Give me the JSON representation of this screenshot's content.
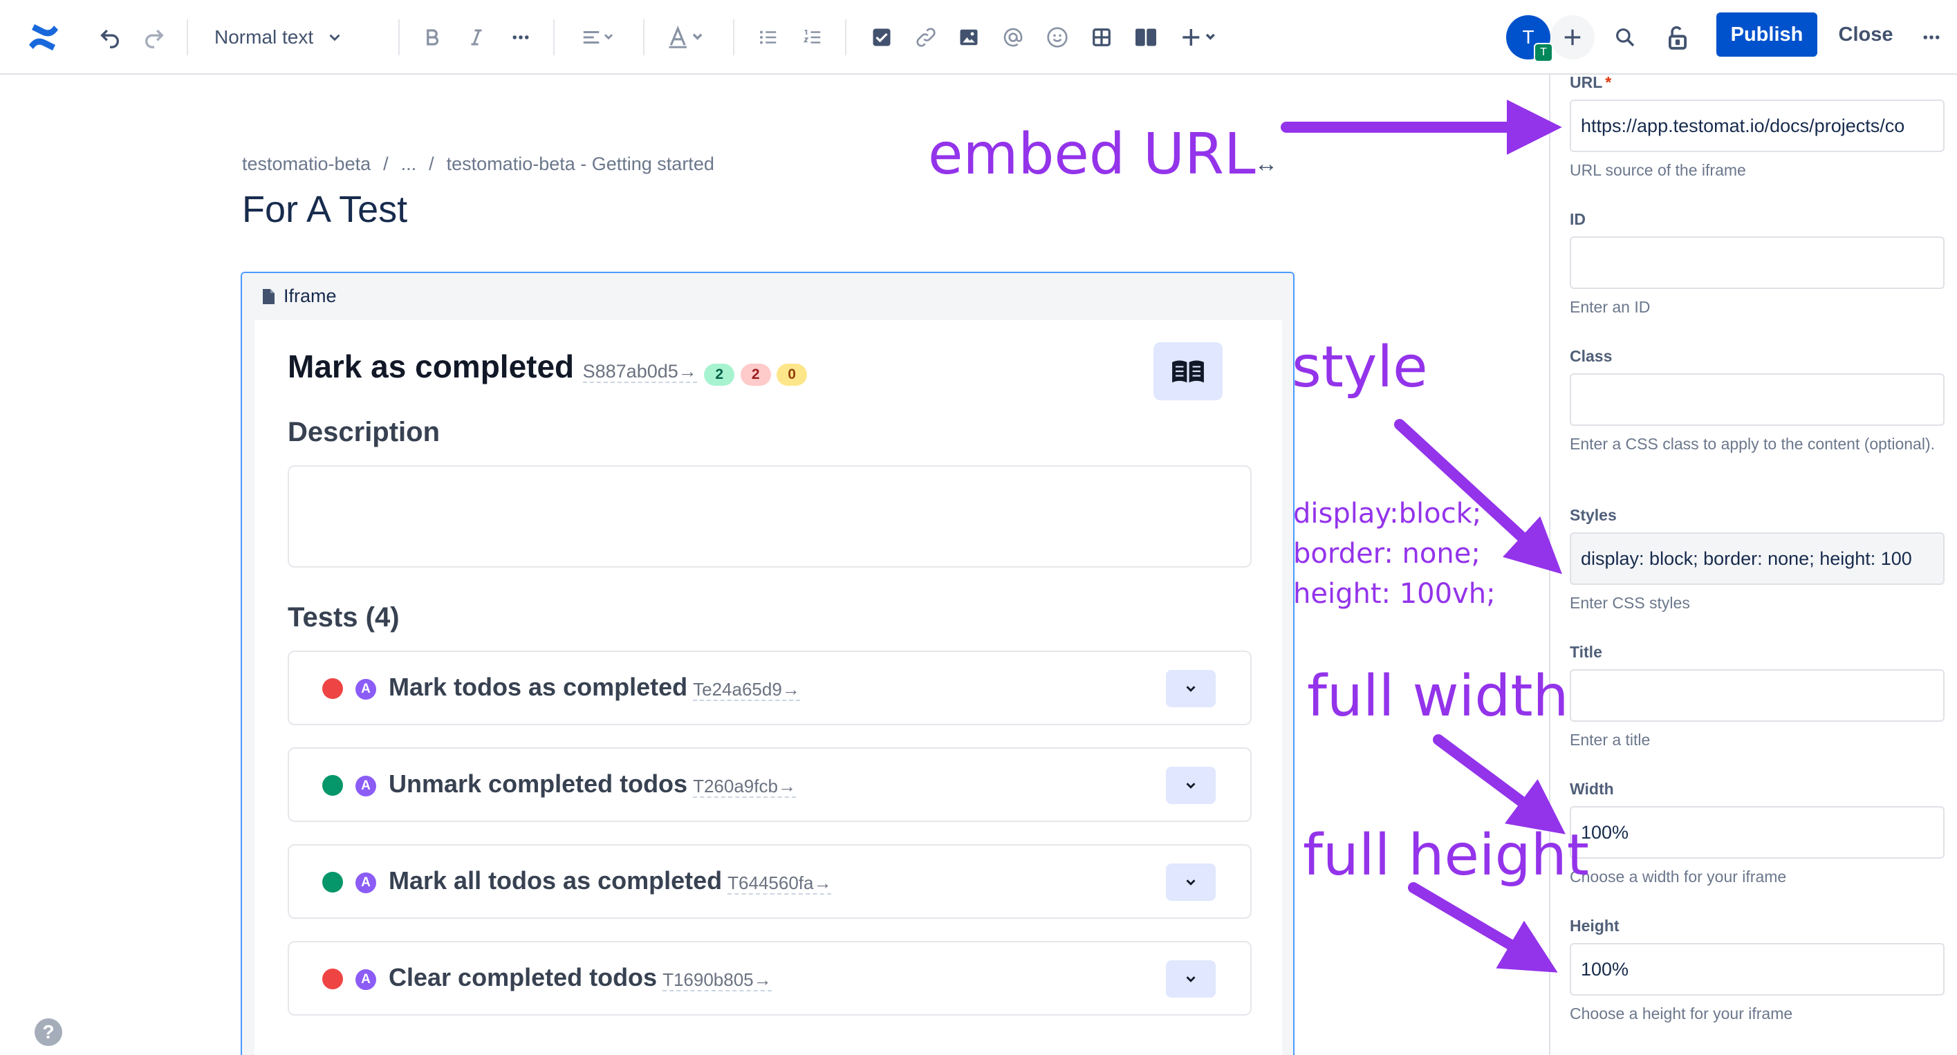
{
  "toolbar": {
    "text_style": "Normal text",
    "publish_label": "Publish",
    "close_label": "Close",
    "avatar_initial": "T",
    "avatar_badge": "T"
  },
  "page": {
    "breadcrumb": [
      "testomatio-beta",
      "/",
      "...",
      "/",
      "testomatio-beta - Getting started"
    ],
    "title": "For A Test"
  },
  "iframe_block": {
    "label": "Iframe",
    "suite_title": "Mark as completed",
    "suite_id": "S887ab0d5→",
    "counts": [
      "2",
      "2",
      "0"
    ],
    "description_label": "Description",
    "tests_label": "Tests (4)",
    "tests": [
      {
        "title": "Mark todos as completed",
        "id": "Te24a65d9→",
        "status": "failed",
        "badge": "A"
      },
      {
        "title": "Unmark completed todos",
        "id": "T260a9fcb→",
        "status": "passed",
        "badge": "A"
      },
      {
        "title": "Mark all todos as completed",
        "id": "T644560fa→",
        "status": "passed",
        "badge": "A"
      },
      {
        "title": "Clear completed todos",
        "id": "T1690b805→",
        "status": "failed",
        "badge": "A"
      }
    ]
  },
  "panel": {
    "url": {
      "label": "URL",
      "required": "*",
      "value": "https://app.testomat.io/docs/projects/co",
      "help": "URL source of the iframe"
    },
    "id": {
      "label": "ID",
      "value": "",
      "help": "Enter an ID"
    },
    "class": {
      "label": "Class",
      "value": "",
      "help": "Enter a CSS class to apply to the content (optional)."
    },
    "styles": {
      "label": "Styles",
      "value": "display: block; border: none; height: 100",
      "help": "Enter CSS styles"
    },
    "title": {
      "label": "Title",
      "value": "",
      "help": "Enter a title"
    },
    "width": {
      "label": "Width",
      "value": "100%",
      "help": "Choose a width for your iframe"
    },
    "height": {
      "label": "Height",
      "value": "100%",
      "help": "Choose a height for your iframe"
    }
  },
  "annotations": {
    "embed": "embed URL",
    "embed_arrows": "↔",
    "style": "style",
    "css_lines": [
      "display:block;",
      "border: none;",
      "height: 100vh;"
    ],
    "full_width": "full width",
    "full_height": "full height"
  },
  "help_glyph": "?",
  "colors": {
    "accent": "#0052cc",
    "annotation": "#9333ea",
    "passed": "#059669",
    "failed": "#ef4444",
    "iframe_border": "#4c9aff"
  }
}
